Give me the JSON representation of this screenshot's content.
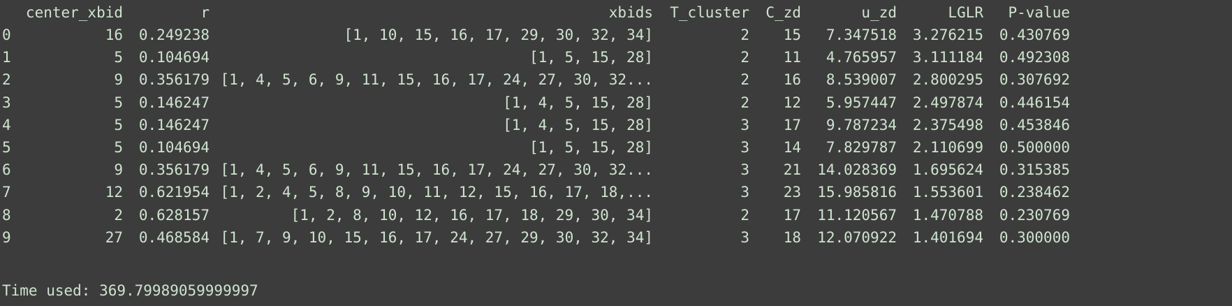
{
  "table": {
    "columns": [
      "center_xbid",
      "r",
      "xbids",
      "T_cluster",
      "C_zd",
      "u_zd",
      "LGLR",
      "P-value"
    ],
    "rows": [
      {
        "index": "0",
        "center_xbid": "16",
        "r": "0.249238",
        "xbids": "[1, 10, 15, 16, 17, 29, 30, 32, 34]",
        "T_cluster": "2",
        "C_zd": "15",
        "u_zd": "7.347518",
        "LGLR": "3.276215",
        "P_value": "0.430769"
      },
      {
        "index": "1",
        "center_xbid": "5",
        "r": "0.104694",
        "xbids": "[1, 5, 15, 28]",
        "T_cluster": "2",
        "C_zd": "11",
        "u_zd": "4.765957",
        "LGLR": "3.111184",
        "P_value": "0.492308"
      },
      {
        "index": "2",
        "center_xbid": "9",
        "r": "0.356179",
        "xbids": "[1, 4, 5, 6, 9, 11, 15, 16, 17, 24, 27, 30, 32...",
        "T_cluster": "2",
        "C_zd": "16",
        "u_zd": "8.539007",
        "LGLR": "2.800295",
        "P_value": "0.307692"
      },
      {
        "index": "3",
        "center_xbid": "5",
        "r": "0.146247",
        "xbids": "[1, 4, 5, 15, 28]",
        "T_cluster": "2",
        "C_zd": "12",
        "u_zd": "5.957447",
        "LGLR": "2.497874",
        "P_value": "0.446154"
      },
      {
        "index": "4",
        "center_xbid": "5",
        "r": "0.146247",
        "xbids": "[1, 4, 5, 15, 28]",
        "T_cluster": "3",
        "C_zd": "17",
        "u_zd": "9.787234",
        "LGLR": "2.375498",
        "P_value": "0.453846"
      },
      {
        "index": "5",
        "center_xbid": "5",
        "r": "0.104694",
        "xbids": "[1, 5, 15, 28]",
        "T_cluster": "3",
        "C_zd": "14",
        "u_zd": "7.829787",
        "LGLR": "2.110699",
        "P_value": "0.500000"
      },
      {
        "index": "6",
        "center_xbid": "9",
        "r": "0.356179",
        "xbids": "[1, 4, 5, 6, 9, 11, 15, 16, 17, 24, 27, 30, 32...",
        "T_cluster": "3",
        "C_zd": "21",
        "u_zd": "14.028369",
        "LGLR": "1.695624",
        "P_value": "0.315385"
      },
      {
        "index": "7",
        "center_xbid": "12",
        "r": "0.621954",
        "xbids": "[1, 2, 4, 5, 8, 9, 10, 11, 12, 15, 16, 17, 18,...",
        "T_cluster": "3",
        "C_zd": "23",
        "u_zd": "15.985816",
        "LGLR": "1.553601",
        "P_value": "0.238462"
      },
      {
        "index": "8",
        "center_xbid": "2",
        "r": "0.628157",
        "xbids": "[1, 2, 8, 10, 12, 16, 17, 18, 29, 30, 34]",
        "T_cluster": "2",
        "C_zd": "17",
        "u_zd": "11.120567",
        "LGLR": "1.470788",
        "P_value": "0.230769"
      },
      {
        "index": "9",
        "center_xbid": "27",
        "r": "0.468584",
        "xbids": "[1, 7, 9, 10, 15, 16, 17, 24, 27, 29, 30, 32, 34]",
        "T_cluster": "3",
        "C_zd": "18",
        "u_zd": "12.070922",
        "LGLR": "1.401694",
        "P_value": "0.300000"
      }
    ]
  },
  "footer": {
    "text": "Time used: 369.79989059999997"
  },
  "colors": {
    "background": "#3c3c3c",
    "text": "#cfe3cf"
  }
}
